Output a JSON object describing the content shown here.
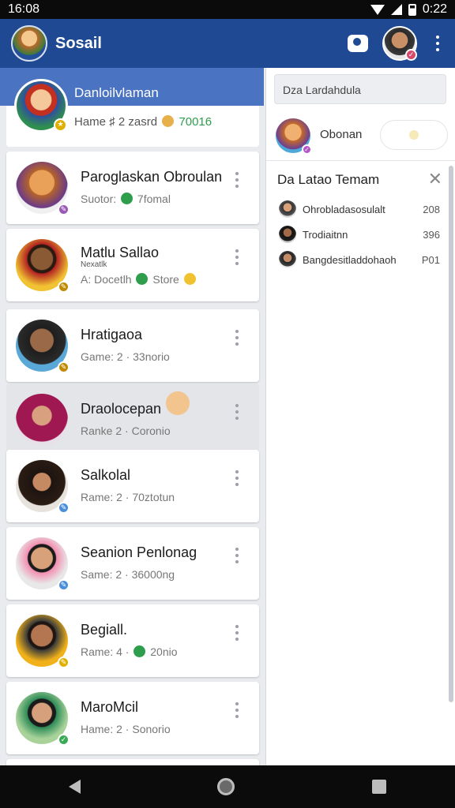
{
  "status": {
    "time": "16:08",
    "battery_text": "0:22"
  },
  "app": {
    "title": "Sosail"
  },
  "selected": {
    "name": "Danloilvlaman",
    "sub": "Hame ♯ 2 zasrd",
    "sub_tail": "70016",
    "accent": "#4a73c2"
  },
  "contacts": [
    {
      "name": "Paroglaskan Obroulan",
      "pre": "Suotor:",
      "post": "7fomal",
      "icon": "green-circle",
      "badge_color": "#9b59b6"
    },
    {
      "name": "Matlu Sallao",
      "tag": "Nexatlk",
      "pre": "A: Docetlh",
      "post": "Store",
      "icon": "green-circle",
      "tail_icon": "smiley",
      "badge_color": "#c08a00"
    },
    {
      "name": "Hratigaoa",
      "pre": "Game: 2 · 33norio",
      "post": "",
      "icon": "",
      "badge_color": "#c08a00"
    },
    {
      "name": "Draolocepan",
      "pre": "Ranke 2 · Coronio",
      "post": "",
      "icon": "",
      "badge_color": "",
      "highlight": true
    },
    {
      "name": "Salkolal",
      "pre": "Rame: 2 · 70ztotun",
      "post": "",
      "icon": "",
      "badge_color": "#4a90d9"
    },
    {
      "name": "Seanion Penlonag",
      "pre": "Same: 2 · 36000ng",
      "post": "",
      "icon": "",
      "badge_color": "#4a90d9"
    },
    {
      "name": "Begiall.",
      "pre": "Rame: 4 ·",
      "post": "20nio",
      "icon": "green-circle",
      "badge_color": "#e0b000"
    },
    {
      "name": "MaroMcil",
      "pre": "Hame: 2 · Sonorio",
      "post": "",
      "icon": "",
      "badge_color": "#3aaa55"
    }
  ],
  "right": {
    "search_text": "Dza Lardahdula",
    "user_name": "Obonan",
    "panel_title": "Da Latao Temam",
    "close_icon": "close-icon",
    "items": [
      {
        "name": "Ohrobladasosulalt",
        "num": "208"
      },
      {
        "name": "Trodiaitnn",
        "num": "396"
      },
      {
        "name": "Bangdesitladdohaoh",
        "num": "P01"
      }
    ]
  },
  "colors": {
    "app_bar": "#1f4a93",
    "accent": "#4a73c2"
  }
}
